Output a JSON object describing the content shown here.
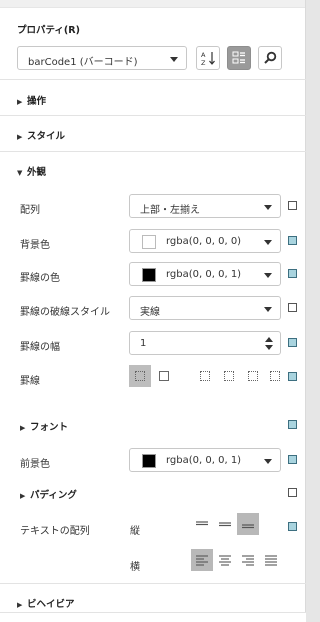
{
  "panel": {
    "title": "プロパティ(R)",
    "object_select": "barCode1 (バーコード)"
  },
  "sections": {
    "operation": "操作",
    "style": "スタイル",
    "appearance": "外観",
    "font": "フォント",
    "padding": "パディング",
    "behavior": "ビヘイビア"
  },
  "props": {
    "alignment": {
      "label": "配列",
      "value": "上部・左揃え"
    },
    "background_color": {
      "label": "背景色",
      "value": "rgba(0, 0, 0, 0)",
      "swatch": "#ffffff"
    },
    "border_color": {
      "label": "罫線の色",
      "value": "rgba(0, 0, 0, 1)",
      "swatch": "#000000"
    },
    "border_dash": {
      "label": "罫線の破線スタイル",
      "value": "実線"
    },
    "border_width": {
      "label": "罫線の幅",
      "value": "1"
    },
    "borders": {
      "label": "罫線"
    },
    "foreground_color": {
      "label": "前景色",
      "value": "rgba(0, 0, 0, 1)",
      "swatch": "#000000"
    },
    "text_alignment": {
      "label": "テキストの配列",
      "vertical": "縦",
      "horizontal": "横"
    }
  },
  "icons": {
    "sort": "sort-az-icon",
    "categorize": "categorized-icon",
    "search": "search-icon"
  },
  "colors": {
    "accent_mark": "#a9d4df",
    "active_button": "#9a9a9a"
  }
}
